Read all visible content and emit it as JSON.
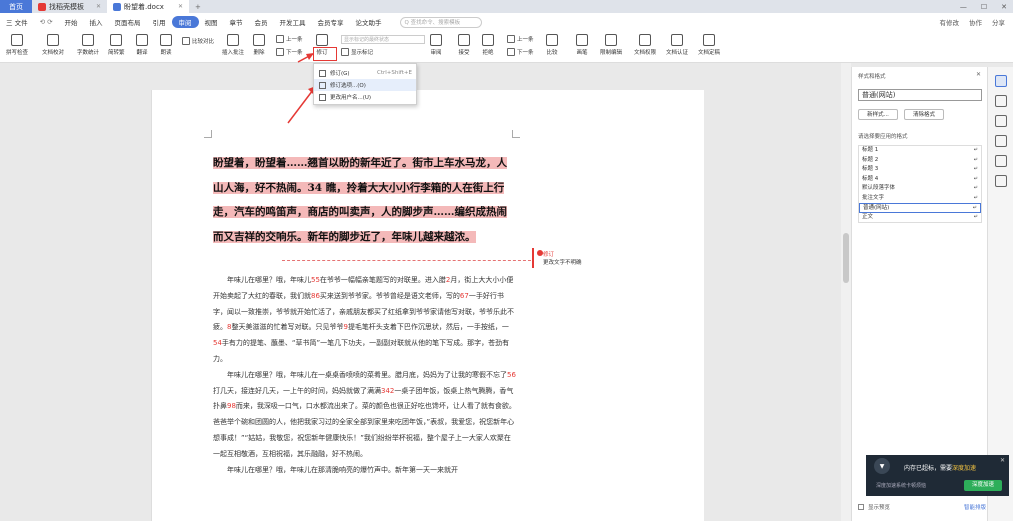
{
  "tabs": {
    "home": "首页",
    "t1": "找稻壳模板",
    "t2": "盼望着.docx"
  },
  "window": {
    "minimize": "—",
    "maximize": "☐",
    "close": "✕"
  },
  "menu": {
    "file": "三 文件",
    "items": [
      "开始",
      "插入",
      "页面布局",
      "引用",
      "审阅",
      "视图",
      "章节",
      "会员",
      "开发工具",
      "会员专享",
      "论文助手"
    ],
    "active_index": 4,
    "search_placeholder": "Q 查找命令、搜索模板",
    "right": [
      "有修改",
      "协作",
      "分享"
    ]
  },
  "ribbon": {
    "spell": "拼写检查",
    "proof": "文档校对",
    "count": "字数统计",
    "trad": "简转繁",
    "translate": "翻译",
    "read": "朗读",
    "compare": "比较对比",
    "insert_comment": "插入批注",
    "delete": "删除",
    "prev_comment": "上一条",
    "next_comment": "下一条",
    "revise": "修订",
    "show_markup": "显示标记",
    "final_field": "显示标记的最终状态",
    "review_pane": "审阅",
    "accept": "接受",
    "reject": "拒绝",
    "prev": "上一条",
    "next": "下一条",
    "compare2": "比较",
    "ink": "画笔",
    "limit_edit": "限制编辑",
    "doc_perm": "文档权限",
    "doc_cert": "文档认证",
    "doc_final": "文档定稿"
  },
  "dropdown_menu": {
    "items": [
      {
        "label": "修订(G)",
        "shortcut": "Ctrl+Shift+E"
      },
      {
        "label": "修订选项...(O)",
        "shortcut": ""
      },
      {
        "label": "更改用户名...(U)",
        "shortcut": ""
      }
    ]
  },
  "document": {
    "heading": "盼望着，盼望着……翘首以盼的新年近了。街市上车水马龙，人山人海，好不热闹。34 瞧，拎着大大小小行李箱的人在街上行走，汽车的鸣笛声，商店的叫卖声，人的脚步声……编织成热闹而又吉祥的交响乐。新年的脚步近了，年味儿越来越浓。",
    "p1": [
      "年味儿在哪里？哦，年味儿",
      "55",
      "在爷爷一幅幅亲笔题写的对联里。进入腊",
      "2",
      "月，街上大大小小便开始卖起了大红的春联，我们就",
      "86",
      "买来送到爷爷家。爷爷曾经是语文老师，写的",
      "67",
      "一手好行书字，闻以一致推崇，爷爷就开始忙活了，亲戚朋友都买了红纸拿到爷爷家请他写对联，爷爷乐此不疲。",
      "8",
      "整天美滋滋的忙着写对联。只见爷爷",
      "9",
      "提毛笔杆头支着下巴作沉思状，然后，一手按纸，一",
      "54",
      "手有力的提笔、蘸墨、“草书简”一笔几下功夫，一副副对联就从他的笔下写成。那字，苍劲有力。"
    ],
    "p2": [
      "年味儿在哪里？哦，年味儿在一桌桌香喷喷的菜肴里。腊月底，妈妈为了让我的寒假不忘了",
      "56",
      "打几天，接连好几天，一上午的时间，妈妈就做了满满",
      "342",
      "一桌子团年饭，饭桌上热气腾腾，香气扑鼻",
      "98",
      "而来，我深吸一口气，口水都流出来了。菜的颜色也很正好吃也馋坏，让人看了就有食欲。爸爸举个碗和团圆的人，他把我家习过的全家全部到家里来吃团年饭，”表叔，我爱您，祝您新年心想事成！”“姑姑，我敬您，祝您新年健康快乐！”我们纷纷举杯祝福，整个屋子上一大家人欢聚在一起互相敬酒，互相祝福，其乐融融，好不热闹。"
    ],
    "p3": "年味儿在哪里？哦，年味儿在那清脆响亮的爆竹声中。新年第一天一来就开"
  },
  "comment": {
    "author": "修订",
    "text": "更改文字不明确"
  },
  "style_pane": {
    "title": "样式和格式",
    "selected": "普通(网站)",
    "new_style": "新样式...",
    "clear": "清除格式",
    "hint": "请选择要应用的格式",
    "items": [
      "标题 1",
      "标题 2",
      "标题 3",
      "标题 4",
      "默认段落字体",
      "批注文字",
      "普通(网站)",
      "正文"
    ],
    "selected_index": 6,
    "show_preview": "显示预览",
    "smart_layout": "智能排版"
  },
  "toast": {
    "title": "内存已超标，需要",
    "title_hl": "深度加速",
    "subtitle": "深度加速系统卡顿烦恼",
    "button": "深度加速"
  },
  "colors": {
    "accent": "#4a78d8",
    "highlight": "#f4b9b9",
    "red": "#e53935"
  }
}
